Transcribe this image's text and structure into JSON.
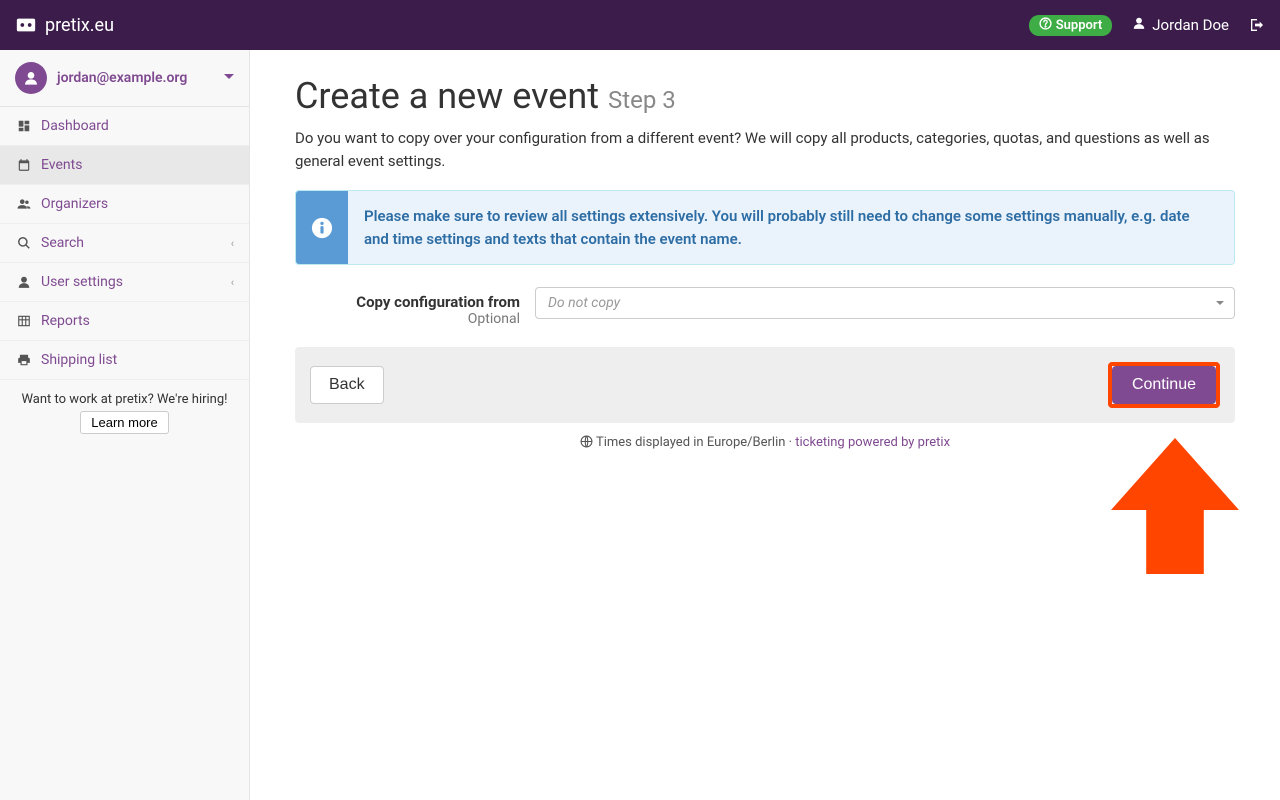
{
  "brand": "pretix.eu",
  "topbar": {
    "support": "Support",
    "user_name": "Jordan Doe"
  },
  "sidebar": {
    "email": "jordan@example.org",
    "items": [
      {
        "label": "Dashboard",
        "icon": "dashboard",
        "active": false
      },
      {
        "label": "Events",
        "icon": "calendar",
        "active": true
      },
      {
        "label": "Organizers",
        "icon": "users",
        "active": false
      },
      {
        "label": "Search",
        "icon": "search",
        "active": false,
        "expandable": true
      },
      {
        "label": "User settings",
        "icon": "user",
        "active": false,
        "expandable": true
      },
      {
        "label": "Reports",
        "icon": "table",
        "active": false
      },
      {
        "label": "Shipping list",
        "icon": "print",
        "active": false
      }
    ],
    "hiring_text": "Want to work at pretix? We're hiring!",
    "hiring_button": "Learn more"
  },
  "page": {
    "title": "Create a new event",
    "step": "Step 3",
    "intro": "Do you want to copy over your configuration from a different event? We will copy all products, categories, quotas, and questions as well as general event settings.",
    "alert": "Please make sure to review all settings extensively. You will probably still need to change some settings manually, e.g. date and time settings and texts that contain the event name.",
    "copy_label": "Copy configuration from",
    "copy_optional": "Optional",
    "copy_placeholder": "Do not copy",
    "back": "Back",
    "continue": "Continue",
    "timezone_text": "Times displayed in Europe/Berlin · ",
    "powered_by": "ticketing powered by pretix"
  }
}
